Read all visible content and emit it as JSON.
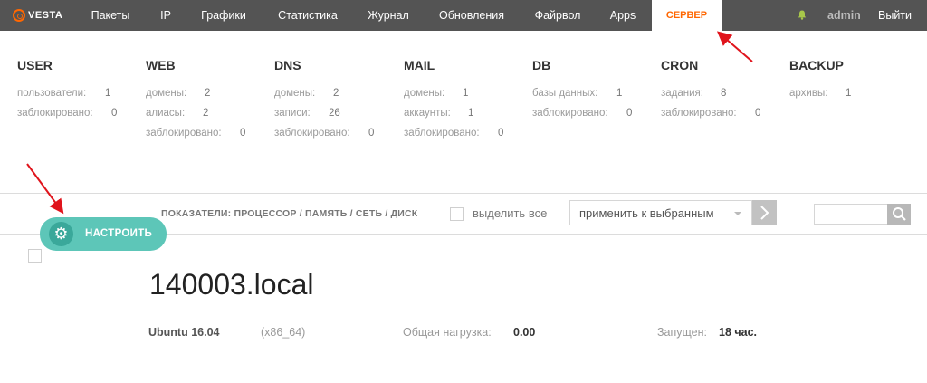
{
  "logo": {
    "text": "VESTA"
  },
  "nav": {
    "items": [
      "Пакеты",
      "IP",
      "Графики",
      "Статистика",
      "Журнал",
      "Обновления",
      "Файрвол",
      "Apps"
    ],
    "active": "СЕРВЕР",
    "user": "admin",
    "logout": "Выйти"
  },
  "stats": [
    {
      "title": "USER",
      "rows": [
        {
          "label": "пользователи:",
          "value": "1"
        },
        {
          "label": "заблокировано:",
          "value": "0"
        }
      ]
    },
    {
      "title": "WEB",
      "rows": [
        {
          "label": "домены:",
          "value": "2"
        },
        {
          "label": "алиасы:",
          "value": "2"
        },
        {
          "label": "заблокировано:",
          "value": "0"
        }
      ]
    },
    {
      "title": "DNS",
      "rows": [
        {
          "label": "домены:",
          "value": "2"
        },
        {
          "label": "записи:",
          "value": "26"
        },
        {
          "label": "заблокировано:",
          "value": "0"
        }
      ]
    },
    {
      "title": "MAIL",
      "rows": [
        {
          "label": "домены:",
          "value": "1"
        },
        {
          "label": "аккаунты:",
          "value": "1"
        },
        {
          "label": "заблокировано:",
          "value": "0"
        }
      ]
    },
    {
      "title": "DB",
      "rows": [
        {
          "label": "базы данных:",
          "value": "1"
        },
        {
          "label": "заблокировано:",
          "value": "0"
        }
      ]
    },
    {
      "title": "CRON",
      "rows": [
        {
          "label": "задания:",
          "value": "8"
        },
        {
          "label": "заблокировано:",
          "value": "0"
        }
      ]
    },
    {
      "title": "BACKUP",
      "rows": [
        {
          "label": "архивы:",
          "value": "1"
        }
      ]
    }
  ],
  "toolbar": {
    "configure_label": "НАСТРОИТЬ",
    "indicators": "ПОКАЗАТЕЛИ: ПРОЦЕССОР / ПАМЯТЬ / СЕТЬ / ДИСК",
    "select_all": "выделить все",
    "action": "применить к выбранным"
  },
  "server": {
    "hostname": "140003.local",
    "os": "Ubuntu 16.04",
    "arch": "(x86_64)",
    "load_label": "Общая нагрузка:",
    "load_value": "0.00",
    "uptime_label": "Запущен:",
    "uptime_value": "18 час."
  },
  "colors": {
    "accent": "#ff6701",
    "topbar": "#545454",
    "configure": "#5dc6b8",
    "arrow": "#e0141c"
  }
}
